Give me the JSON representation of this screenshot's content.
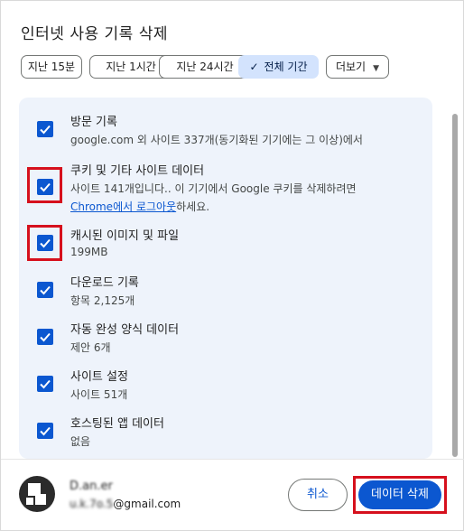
{
  "dialog": {
    "title": "인터넷 사용 기록 삭제"
  },
  "time_chips": [
    {
      "label": "지난 15분",
      "selected": false
    },
    {
      "label": "지난 1시간",
      "selected": false
    },
    {
      "label": "지난 24시간",
      "selected": false
    },
    {
      "label": "전체 기간",
      "selected": true
    },
    {
      "label": "더보기",
      "selected": false
    }
  ],
  "items": [
    {
      "title": "방문 기록",
      "sub": "google.com 외 사이트 337개(동기화된 기기에는 그 이상)에서",
      "checked": true
    },
    {
      "title": "쿠키 및 기타 사이트 데이터",
      "sub": "사이트 141개입니다.. 이 기기에서 Google 쿠키를 삭제하려면",
      "sub_link": "Chrome에서 로그아웃",
      "sub_tail": "하세요.",
      "checked": true
    },
    {
      "title": "캐시된 이미지 및 파일",
      "sub": "199MB",
      "checked": true
    },
    {
      "title": "다운로드 기록",
      "sub": "항목 2,125개",
      "checked": true
    },
    {
      "title": "자동 완성 양식 데이터",
      "sub": "제안 6개",
      "checked": true
    },
    {
      "title": "사이트 설정",
      "sub": "사이트 51개",
      "checked": true
    },
    {
      "title": "호스팅된 앱 데이터",
      "sub": "없음",
      "checked": true
    }
  ],
  "account": {
    "name": "D.an.er",
    "email_prefix": "u.k.7o.5",
    "email_domain": "@gmail.com"
  },
  "buttons": {
    "cancel": "취소",
    "delete": "데이터 삭제"
  },
  "colors": {
    "accent": "#0b57d0",
    "panel_bg": "#eef3fb",
    "chip_selected": "#d3e3fd",
    "highlight": "#d6101d"
  }
}
